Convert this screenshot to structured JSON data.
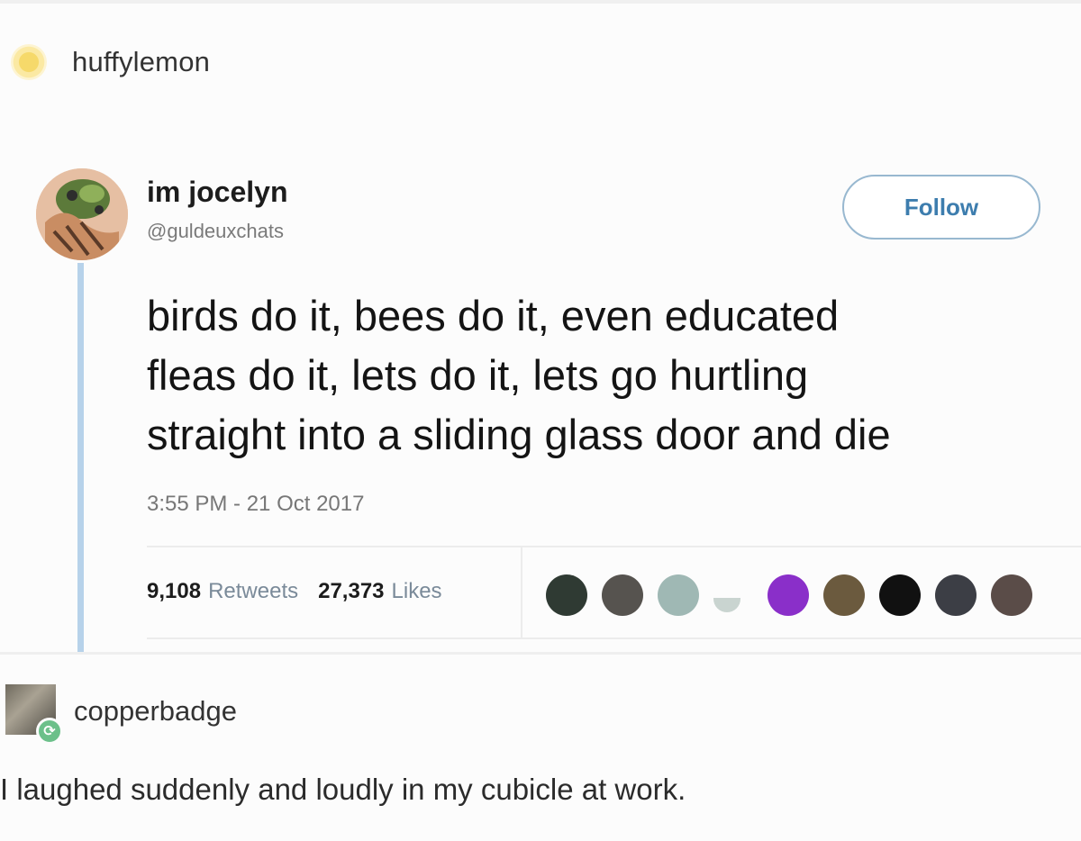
{
  "post": {
    "username": "huffylemon",
    "avatar_icon": "sun-avatar-icon"
  },
  "tweet": {
    "display_name": "im jocelyn",
    "handle": "@guldeuxchats",
    "follow_label": "Follow",
    "text": "birds do it, bees do it, even educated\nfleas do it, lets do it, lets go hurtling\nstraight into a sliding glass door and die",
    "timestamp": "3:55 PM - 21 Oct 2017",
    "retweets_count": "9,108",
    "retweets_label": "Retweets",
    "likes_count": "27,373",
    "likes_label": "Likes",
    "liker_avatar_colors": [
      "#2f3a33",
      "#56534f",
      "#9fb8b4",
      "#c9d4d0",
      "#8a2fc9",
      "#6b5a3e",
      "#111111",
      "#3c3e45",
      "#5a4c48"
    ]
  },
  "reblog": {
    "username": "copperbadge",
    "badge_icon": "reblog-icon",
    "comment": "I laughed suddenly and loudly in my cubicle at work."
  },
  "colors": {
    "follow_accent": "#3d7dae",
    "thread_line": "#b7d2ea",
    "reblog_badge": "#6cc08a"
  }
}
